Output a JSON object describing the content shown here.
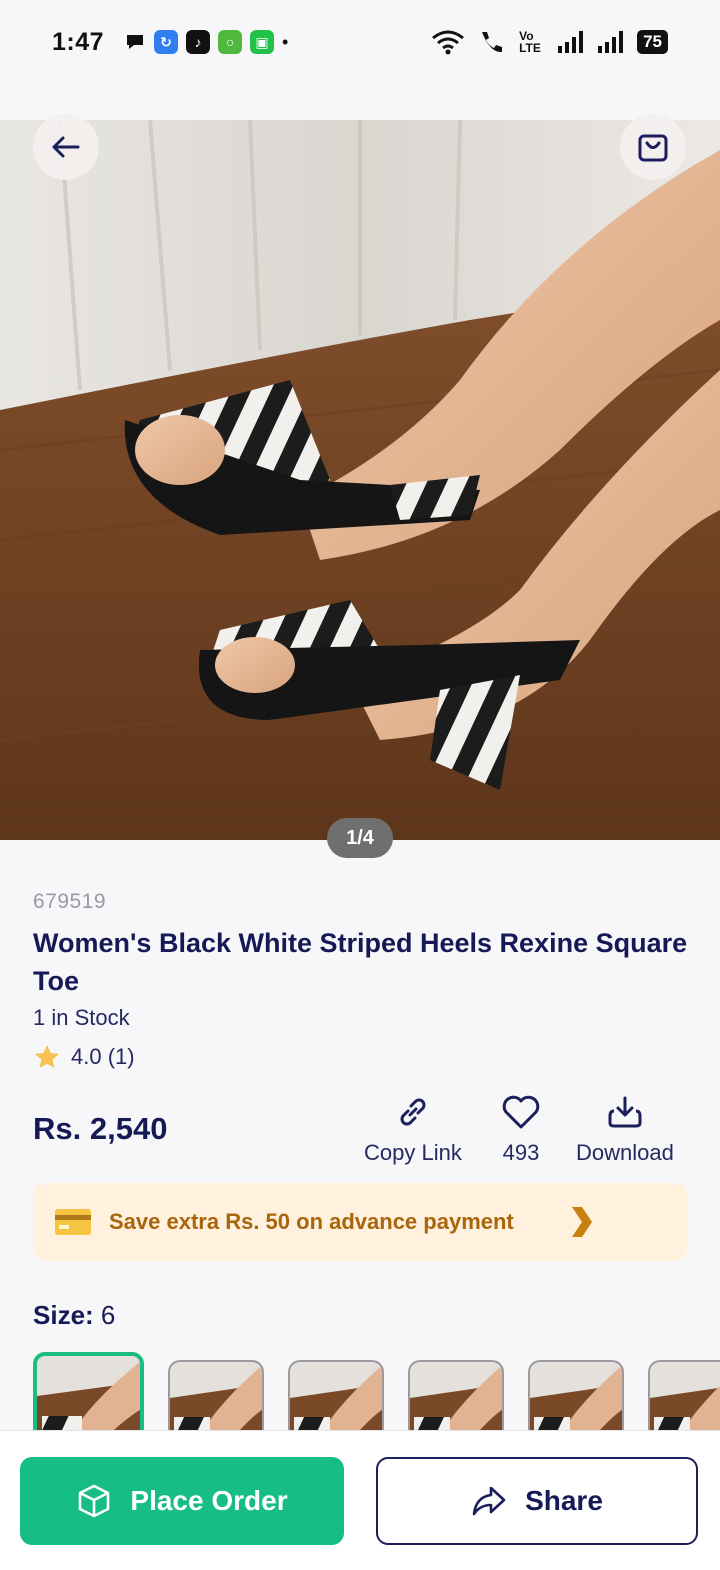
{
  "status_bar": {
    "time": "1:47",
    "network_label": "Vo LTE",
    "battery": "75"
  },
  "product": {
    "image_pager": "1/4",
    "sku": "679519",
    "title": "Women's Black White Striped Heels Rexine Square Toe",
    "stock": "1 in Stock",
    "rating": "4.0 (1)",
    "price": "Rs. 2,540"
  },
  "actions": {
    "copy_link": "Copy Link",
    "likes": "493",
    "download": "Download"
  },
  "promo": {
    "text": "Save extra Rs. 50 on advance payment"
  },
  "size": {
    "label": "Size:",
    "value": "6"
  },
  "bottom": {
    "place_order": "Place Order",
    "share": "Share"
  },
  "colors": {
    "primary_green": "#16bd84",
    "navy": "#151a57",
    "promo_bg": "#fff1de",
    "promo_text": "#a8650c"
  },
  "icons": [
    "back-arrow-icon",
    "shopping-bag-icon",
    "link-icon",
    "heart-icon",
    "download-icon",
    "credit-card-icon",
    "chevron-right-icon",
    "package-icon",
    "share-icon",
    "star-icon"
  ]
}
